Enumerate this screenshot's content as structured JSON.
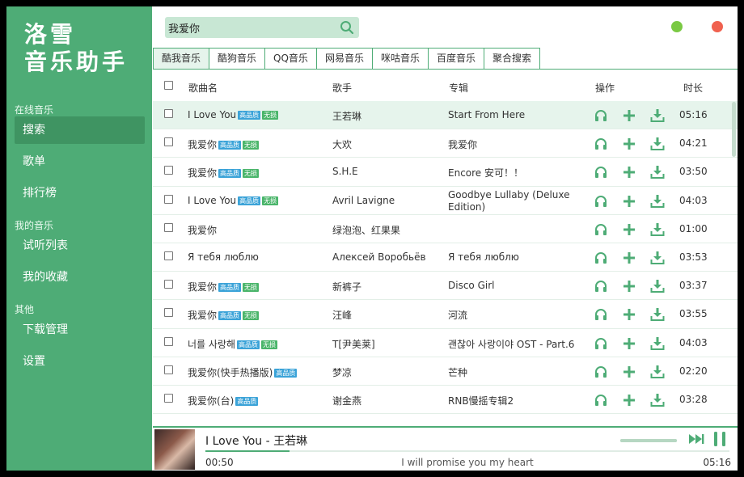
{
  "app": {
    "logo_line1": "洛雪",
    "logo_line2": "音乐助手"
  },
  "sidebar": {
    "sections": [
      {
        "title": "在线音乐",
        "items": [
          "搜索",
          "歌单",
          "排行榜"
        ]
      },
      {
        "title": "我的音乐",
        "items": [
          "试听列表",
          "我的收藏"
        ]
      },
      {
        "title": "其他",
        "items": [
          "下载管理",
          "设置"
        ]
      }
    ],
    "active_item": "搜索"
  },
  "search": {
    "value": "我爱你",
    "placeholder": ""
  },
  "tabs": [
    "酷我音乐",
    "酷狗音乐",
    "QQ音乐",
    "网易音乐",
    "咪咕音乐",
    "百度音乐",
    "聚合搜索"
  ],
  "active_tab": "酷我音乐",
  "table": {
    "headers": {
      "name": "歌曲名",
      "artist": "歌手",
      "album": "专辑",
      "actions": "操作",
      "duration": "时长"
    },
    "badges": {
      "hq": "高品质",
      "lossless": "无损"
    },
    "rows": [
      {
        "name": "I Love You",
        "hq": true,
        "ll": true,
        "artist": "王若琳",
        "album": "Start From Here",
        "duration": "05:16"
      },
      {
        "name": "我爱你",
        "hq": true,
        "ll": true,
        "artist": "大欢",
        "album": "我爱你",
        "duration": "04:21"
      },
      {
        "name": "我爱你",
        "hq": true,
        "ll": true,
        "artist": "S.H.E",
        "album": "Encore 安可！！",
        "duration": "03:50"
      },
      {
        "name": "I Love You",
        "hq": true,
        "ll": true,
        "artist": "Avril Lavigne",
        "album": "Goodbye Lullaby (Deluxe Edition)",
        "duration": "04:03"
      },
      {
        "name": "我爱你",
        "hq": false,
        "ll": false,
        "artist": "绿泡泡、红果果",
        "album": "",
        "duration": "01:00"
      },
      {
        "name": "Я тебя люблю",
        "hq": false,
        "ll": false,
        "artist": "Алексей Воробьёв",
        "album": "Я тебя люблю",
        "duration": "03:53"
      },
      {
        "name": "我爱你",
        "hq": true,
        "ll": true,
        "artist": "新裤子",
        "album": "Disco Girl",
        "duration": "03:37"
      },
      {
        "name": "我爱你",
        "hq": true,
        "ll": true,
        "artist": "汪峰",
        "album": "河流",
        "duration": "03:55"
      },
      {
        "name": "너를 사랑해",
        "hq": true,
        "ll": true,
        "artist": "T[尹美莱]",
        "album": "괜찮아 사랑이야 OST - Part.6",
        "duration": "04:03"
      },
      {
        "name": "我爱你(快手热播版)",
        "hq": true,
        "ll": false,
        "artist": "梦凉",
        "album": "芒种",
        "duration": "02:20"
      },
      {
        "name": "我爱你(台)",
        "hq": true,
        "ll": false,
        "artist": "谢金燕",
        "album": "RNB慢摇专辑2",
        "duration": "03:28"
      }
    ]
  },
  "player": {
    "title": "I Love You - 王若琳",
    "current_time": "00:50",
    "total_time": "05:16",
    "progress_percent": 16,
    "lyric": "I will promise you my heart",
    "volume_percent": 100
  },
  "colors": {
    "accent": "#4eac76",
    "accent_dark": "#3f9462",
    "light": "#e6f4ec"
  }
}
